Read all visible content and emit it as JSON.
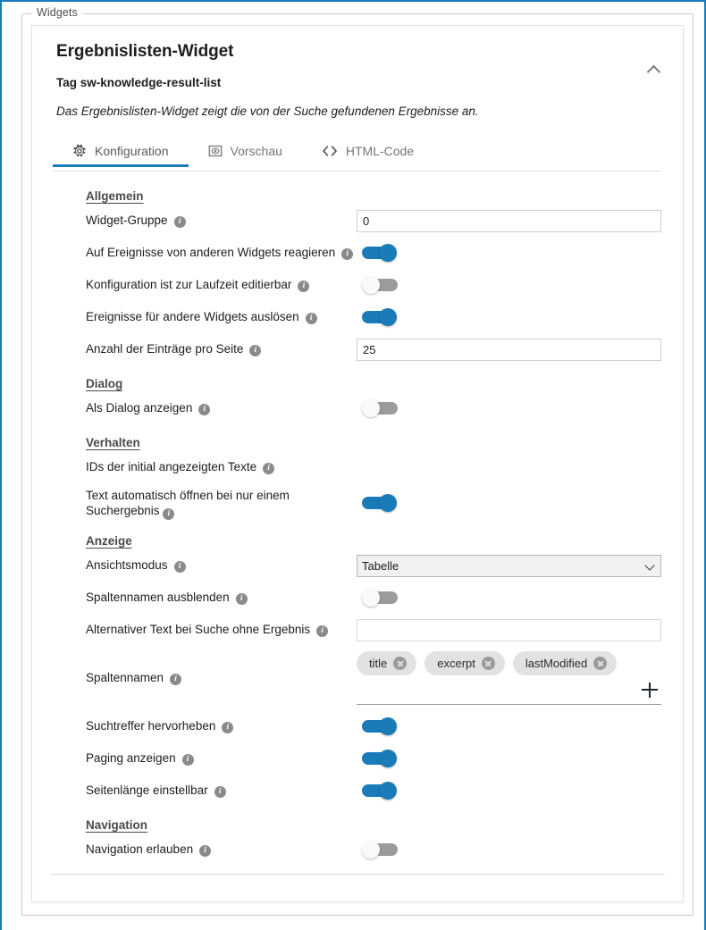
{
  "fieldset": {
    "legend": "Widgets"
  },
  "widget": {
    "title": "Ergebnislisten-Widget",
    "tag": "Tag sw-knowledge-result-list",
    "description": "Das Ergebnislisten-Widget zeigt die von der Suche gefundenen Ergebnisse an.",
    "collapse_icon": "chevron-up-icon"
  },
  "tabs": [
    {
      "label": "Konfiguration",
      "icon": "gear-icon",
      "active": true
    },
    {
      "label": "Vorschau",
      "icon": "eye-icon",
      "active": false
    },
    {
      "label": "HTML-Code",
      "icon": "code-icon",
      "active": false
    }
  ],
  "sections": {
    "allgemein": "Allgemein",
    "dialog": "Dialog",
    "verhalten": "Verhalten",
    "anzeige": "Anzeige",
    "navigation": "Navigation"
  },
  "fields": {
    "widget_gruppe": {
      "label": "Widget-Gruppe",
      "value": "0"
    },
    "auf_ereignisse_reagieren": {
      "label": "Auf Ereignisse von anderen Widgets reagieren",
      "state": "on"
    },
    "konfiguration_laufzeit": {
      "label": "Konfiguration ist zur Laufzeit editierbar",
      "state": "off"
    },
    "ereignisse_ausloesen": {
      "label": "Ereignisse für andere Widgets auslösen",
      "state": "on"
    },
    "anzahl_eintraege": {
      "label": "Anzahl der Einträge pro Seite",
      "value": "25"
    },
    "als_dialog": {
      "label": "Als Dialog anzeigen",
      "state": "off"
    },
    "ids_initial": {
      "label": "IDs der initial angezeigten Texte"
    },
    "text_auto_oeffnen": {
      "label_line1": "Text automatisch öffnen bei nur einem",
      "label_line2": "Suchergebnis",
      "state": "on"
    },
    "ansichtsmodus": {
      "label": "Ansichtsmodus",
      "value": "Tabelle",
      "options": [
        "Tabelle"
      ]
    },
    "spaltennamen_ausblenden": {
      "label": "Spaltennamen ausblenden",
      "state": "off"
    },
    "alternativer_text": {
      "label": "Alternativer Text bei Suche ohne Ergebnis",
      "value": "",
      "placeholder": ""
    },
    "spaltennamen": {
      "label": "Spaltennamen",
      "chips": [
        "title",
        "excerpt",
        "lastModified"
      ],
      "add_icon": "plus-icon"
    },
    "suchtreffer_hervorheben": {
      "label": "Suchtreffer hervorheben",
      "state": "on"
    },
    "paging_anzeigen": {
      "label": "Paging anzeigen",
      "state": "on"
    },
    "seitenlaenge_einstellbar": {
      "label": "Seitenlänge einstellbar",
      "state": "on"
    },
    "navigation_erlauben": {
      "label": "Navigation erlauben",
      "state": "off"
    }
  },
  "colors": {
    "accent": "#1a7bb9",
    "toggle_off_track": "#9b9b9b",
    "chip_bg": "#e2e2e2"
  },
  "icons": {
    "info": "info-icon",
    "chip_remove": "close-circle-icon"
  }
}
